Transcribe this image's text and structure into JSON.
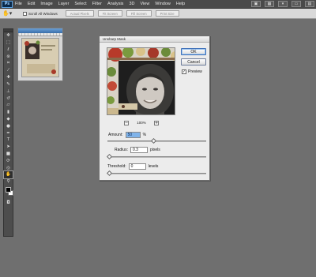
{
  "app": {
    "logo": "Ps"
  },
  "menubar": {
    "items": [
      "File",
      "Edit",
      "Image",
      "Layer",
      "Select",
      "Filter",
      "Analysis",
      "3D",
      "View",
      "Window",
      "Help"
    ]
  },
  "options_bar": {
    "scroll_all_label": "Scroll All Windows",
    "buttons": [
      "Actual Pixels",
      "Fit Screen",
      "Fill Screen",
      "Print Size"
    ]
  },
  "toolbox": {
    "tools": [
      "move",
      "marquee",
      "lasso",
      "quick-select",
      "crop",
      "eyedropper",
      "healing",
      "brush",
      "clone-stamp",
      "history-brush",
      "eraser",
      "gradient",
      "blur",
      "dodge",
      "pen",
      "type",
      "path-select",
      "shape",
      "3d-rotate",
      "3d-orbit",
      "hand",
      "zoom"
    ],
    "active_tool": "hand",
    "foreground_color": "#000000",
    "background_color": "#ffffff"
  },
  "dialog": {
    "title": "Unsharp Mask",
    "ok_label": "OK",
    "cancel_label": "Cancel",
    "preview_label": "Preview",
    "preview_checked": true,
    "zoom_level": "100%",
    "amount_label": "Amount:",
    "amount_value": "50",
    "amount_unit": "%",
    "radius_label": "Radius:",
    "radius_value": "0.3",
    "radius_unit": "pixels",
    "threshold_label": "Threshold:",
    "threshold_value": "0",
    "threshold_unit": "levels"
  }
}
